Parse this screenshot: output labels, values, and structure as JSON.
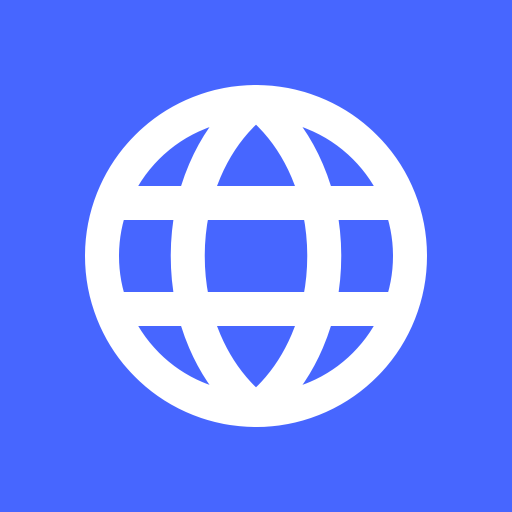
{
  "icon": {
    "name": "globe-icon",
    "background_color": "#4766FF",
    "foreground_color": "#FFFFFF"
  }
}
